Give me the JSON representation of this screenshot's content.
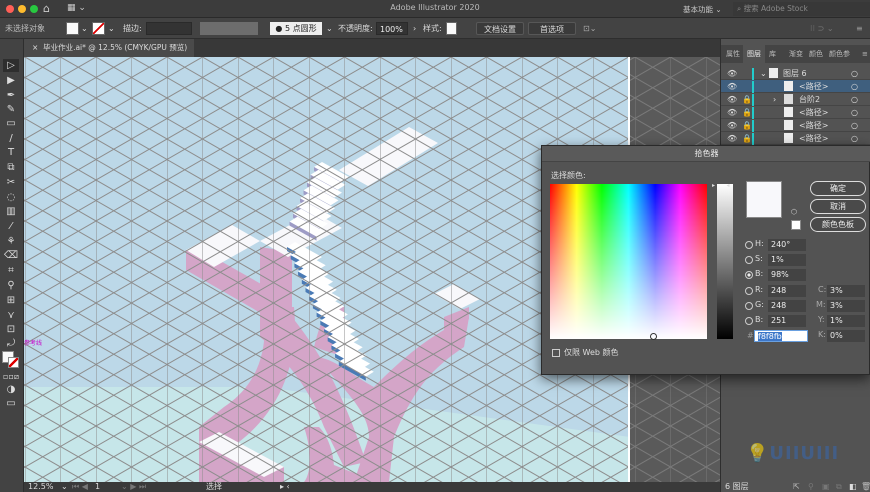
{
  "app": {
    "title": "Adobe Illustrator 2020",
    "workspace": "基本功能",
    "search_placeholder": "搜索 Adobe Stock"
  },
  "control_bar": {
    "selection": "未选择对象",
    "stroke_label": "描边:",
    "brush": "5 点圆形",
    "opacity_label": "不透明度:",
    "opacity": "100%",
    "style_label": "样式:",
    "doc_setup": "文档设置",
    "preferences": "首选项"
  },
  "document_tab": {
    "title": "毕业作业.ai* @ 12.5% (CMYK/GPU 预览)"
  },
  "canvas": {
    "guide_label": "参考线",
    "colors": {
      "background": "#bcd8e8",
      "pink": "#d4a5c8",
      "stairs_blue": "#4a7ab5",
      "stairs_purple": "#9e9cc6",
      "platform": "#f8f8fb"
    }
  },
  "status_bar": {
    "zoom": "12.5%",
    "artboard": "1",
    "tool": "选择"
  },
  "panel": {
    "tabs": [
      "属性",
      "图层",
      "库",
      "渐变",
      "颜色",
      "颜色参"
    ],
    "active_tab": "图层",
    "layers": [
      {
        "name": "图层 6",
        "visible": true,
        "locked": false,
        "expanded": true
      },
      {
        "name": "<路径>",
        "visible": true,
        "locked": false,
        "selected": true
      },
      {
        "name": "台阶2",
        "visible": true,
        "locked": true,
        "collapsed": true
      },
      {
        "name": "<路径>",
        "visible": true,
        "locked": true
      },
      {
        "name": "<路径>",
        "visible": true,
        "locked": true
      },
      {
        "name": "<路径>",
        "visible": true,
        "locked": true
      }
    ],
    "footer": "6 图层",
    "watermark": "UIIUIII"
  },
  "color_picker": {
    "title": "拾色器",
    "select_label": "选择颜色:",
    "ok": "确定",
    "cancel": "取消",
    "swatches": "颜色色板",
    "web_only": "仅限 Web 颜色",
    "web_only_checked": false,
    "selected_mode": "B",
    "fields": {
      "H": "240°",
      "S": "1%",
      "B": "98%",
      "R": "248",
      "G": "248",
      "B2": "251",
      "C": "3%",
      "M": "3%",
      "Y": "1%",
      "K": "0%",
      "hex": "f8f8fb"
    },
    "labels": {
      "H": "H:",
      "S": "S:",
      "B": "B:",
      "R": "R:",
      "G": "G:",
      "B2": "B:",
      "C": "C:",
      "M": "M:",
      "Y": "Y:",
      "K": "K:",
      "hash": "#"
    },
    "current_color": "#f8f8fb"
  }
}
